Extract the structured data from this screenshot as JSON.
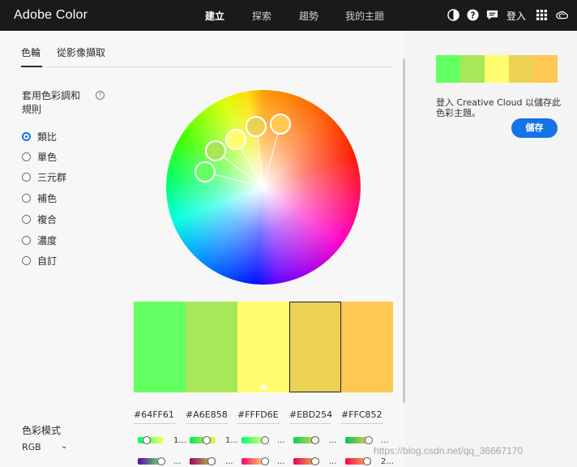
{
  "header": {
    "brand": "Adobe Color",
    "nav": [
      "建立",
      "探索",
      "趨勢",
      "我的主題"
    ],
    "active_nav": "建立",
    "sign_in": "登入",
    "icons": [
      "contrast-icon",
      "help-icon",
      "chat-icon",
      "apps-grid-icon",
      "creative-cloud-icon"
    ]
  },
  "tabs": [
    "色輪",
    "從影像擷取"
  ],
  "harmony": {
    "label": "套用色彩調和規則",
    "help_glyph": "?",
    "rules": [
      "類比",
      "單色",
      "三元群",
      "補色",
      "複合",
      "濃度",
      "自訂"
    ],
    "selected": "類比"
  },
  "swatches": [
    "#64FF61",
    "#A6E858",
    "#FFFD6E",
    "#EBD254",
    "#FFC852"
  ],
  "swatch_selected_index": 3,
  "swatch_base_index": 2,
  "color_mode": {
    "label": "色彩模式",
    "value": "RGB"
  },
  "slider_values": [
    "1...",
    "1...",
    "...",
    "...",
    "..."
  ],
  "slider_values_row2": [
    "...",
    "...",
    "...",
    "...",
    "2..."
  ],
  "theme": {
    "save_message": "登入 Creative Cloud 以儲存此色彩主題。",
    "save_button": "儲存"
  },
  "watermark": "https://blog.csdn.net/qq_36667170"
}
